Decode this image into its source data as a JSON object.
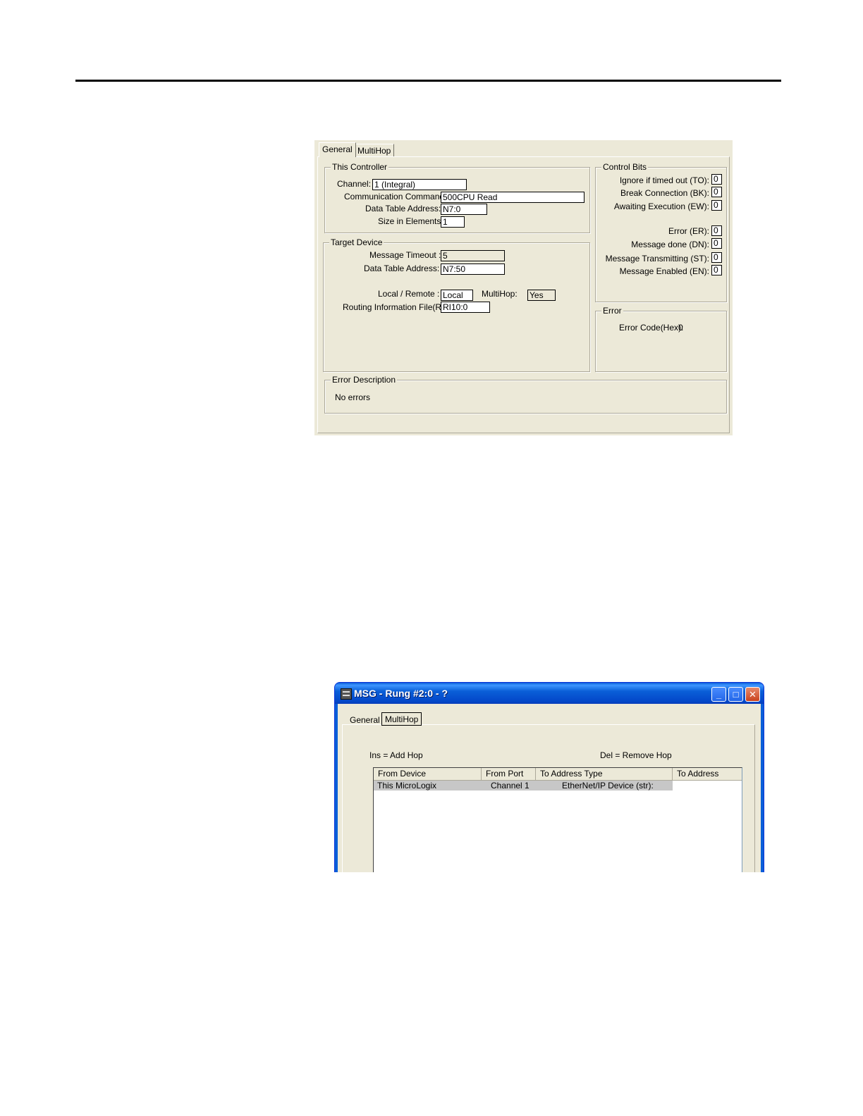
{
  "general_dialog": {
    "tabs": [
      {
        "label": "General"
      },
      {
        "label": "MultiHop"
      }
    ],
    "this_controller": {
      "legend": "This Controller",
      "channel_label": "Channel:",
      "channel_value": "1 (Integral)",
      "comm_command_label": "Communication Command:",
      "comm_command_value": "500CPU Read",
      "data_table_address_label": "Data Table Address:",
      "data_table_address_value": "N7:0",
      "size_label": "Size in Elements:",
      "size_value": "1"
    },
    "target_device": {
      "legend": "Target Device",
      "timeout_label": "Message Timeout :",
      "timeout_value": "5",
      "data_table_address_label": "Data Table Address:",
      "data_table_address_value": "N7:50",
      "local_remote_label": "Local / Remote :",
      "local_remote_value": "Local",
      "multihop_label": "MultiHop:",
      "multihop_value": "Yes",
      "routing_label": "Routing Information File(RI):",
      "routing_value": "RI10:0"
    },
    "control_bits": {
      "legend": "Control Bits",
      "bits": [
        {
          "label": "Ignore if timed out (TO):",
          "value": "0"
        },
        {
          "label": "Break Connection (BK):",
          "value": "0"
        },
        {
          "label": "Awaiting Execution (EW):",
          "value": "0"
        },
        {
          "label": "Error (ER):",
          "value": "0"
        },
        {
          "label": "Message done (DN):",
          "value": "0"
        },
        {
          "label": "Message Transmitting (ST):",
          "value": "0"
        },
        {
          "label": "Message Enabled (EN):",
          "value": "0"
        }
      ]
    },
    "error": {
      "legend": "Error",
      "code_label": "Error Code(Hex):",
      "code_value": "0"
    },
    "error_description": {
      "legend": "Error Description",
      "text": "No errors"
    }
  },
  "multihop_window": {
    "title": "MSG - Rung #2:0 - ?",
    "window_buttons": {
      "minimize": "_",
      "maximize": "□",
      "close": "✕"
    },
    "tabs": [
      {
        "label": "General"
      },
      {
        "label": "MultiHop"
      }
    ],
    "hint_add": "Ins = Add Hop",
    "hint_remove": "Del = Remove Hop",
    "table": {
      "columns": [
        "From Device",
        "From Port",
        "To Address Type",
        "To Address"
      ],
      "rows": [
        [
          "This MicroLogix",
          "Channel  1",
          "EtherNet/IP Device (str):",
          ""
        ]
      ]
    }
  }
}
